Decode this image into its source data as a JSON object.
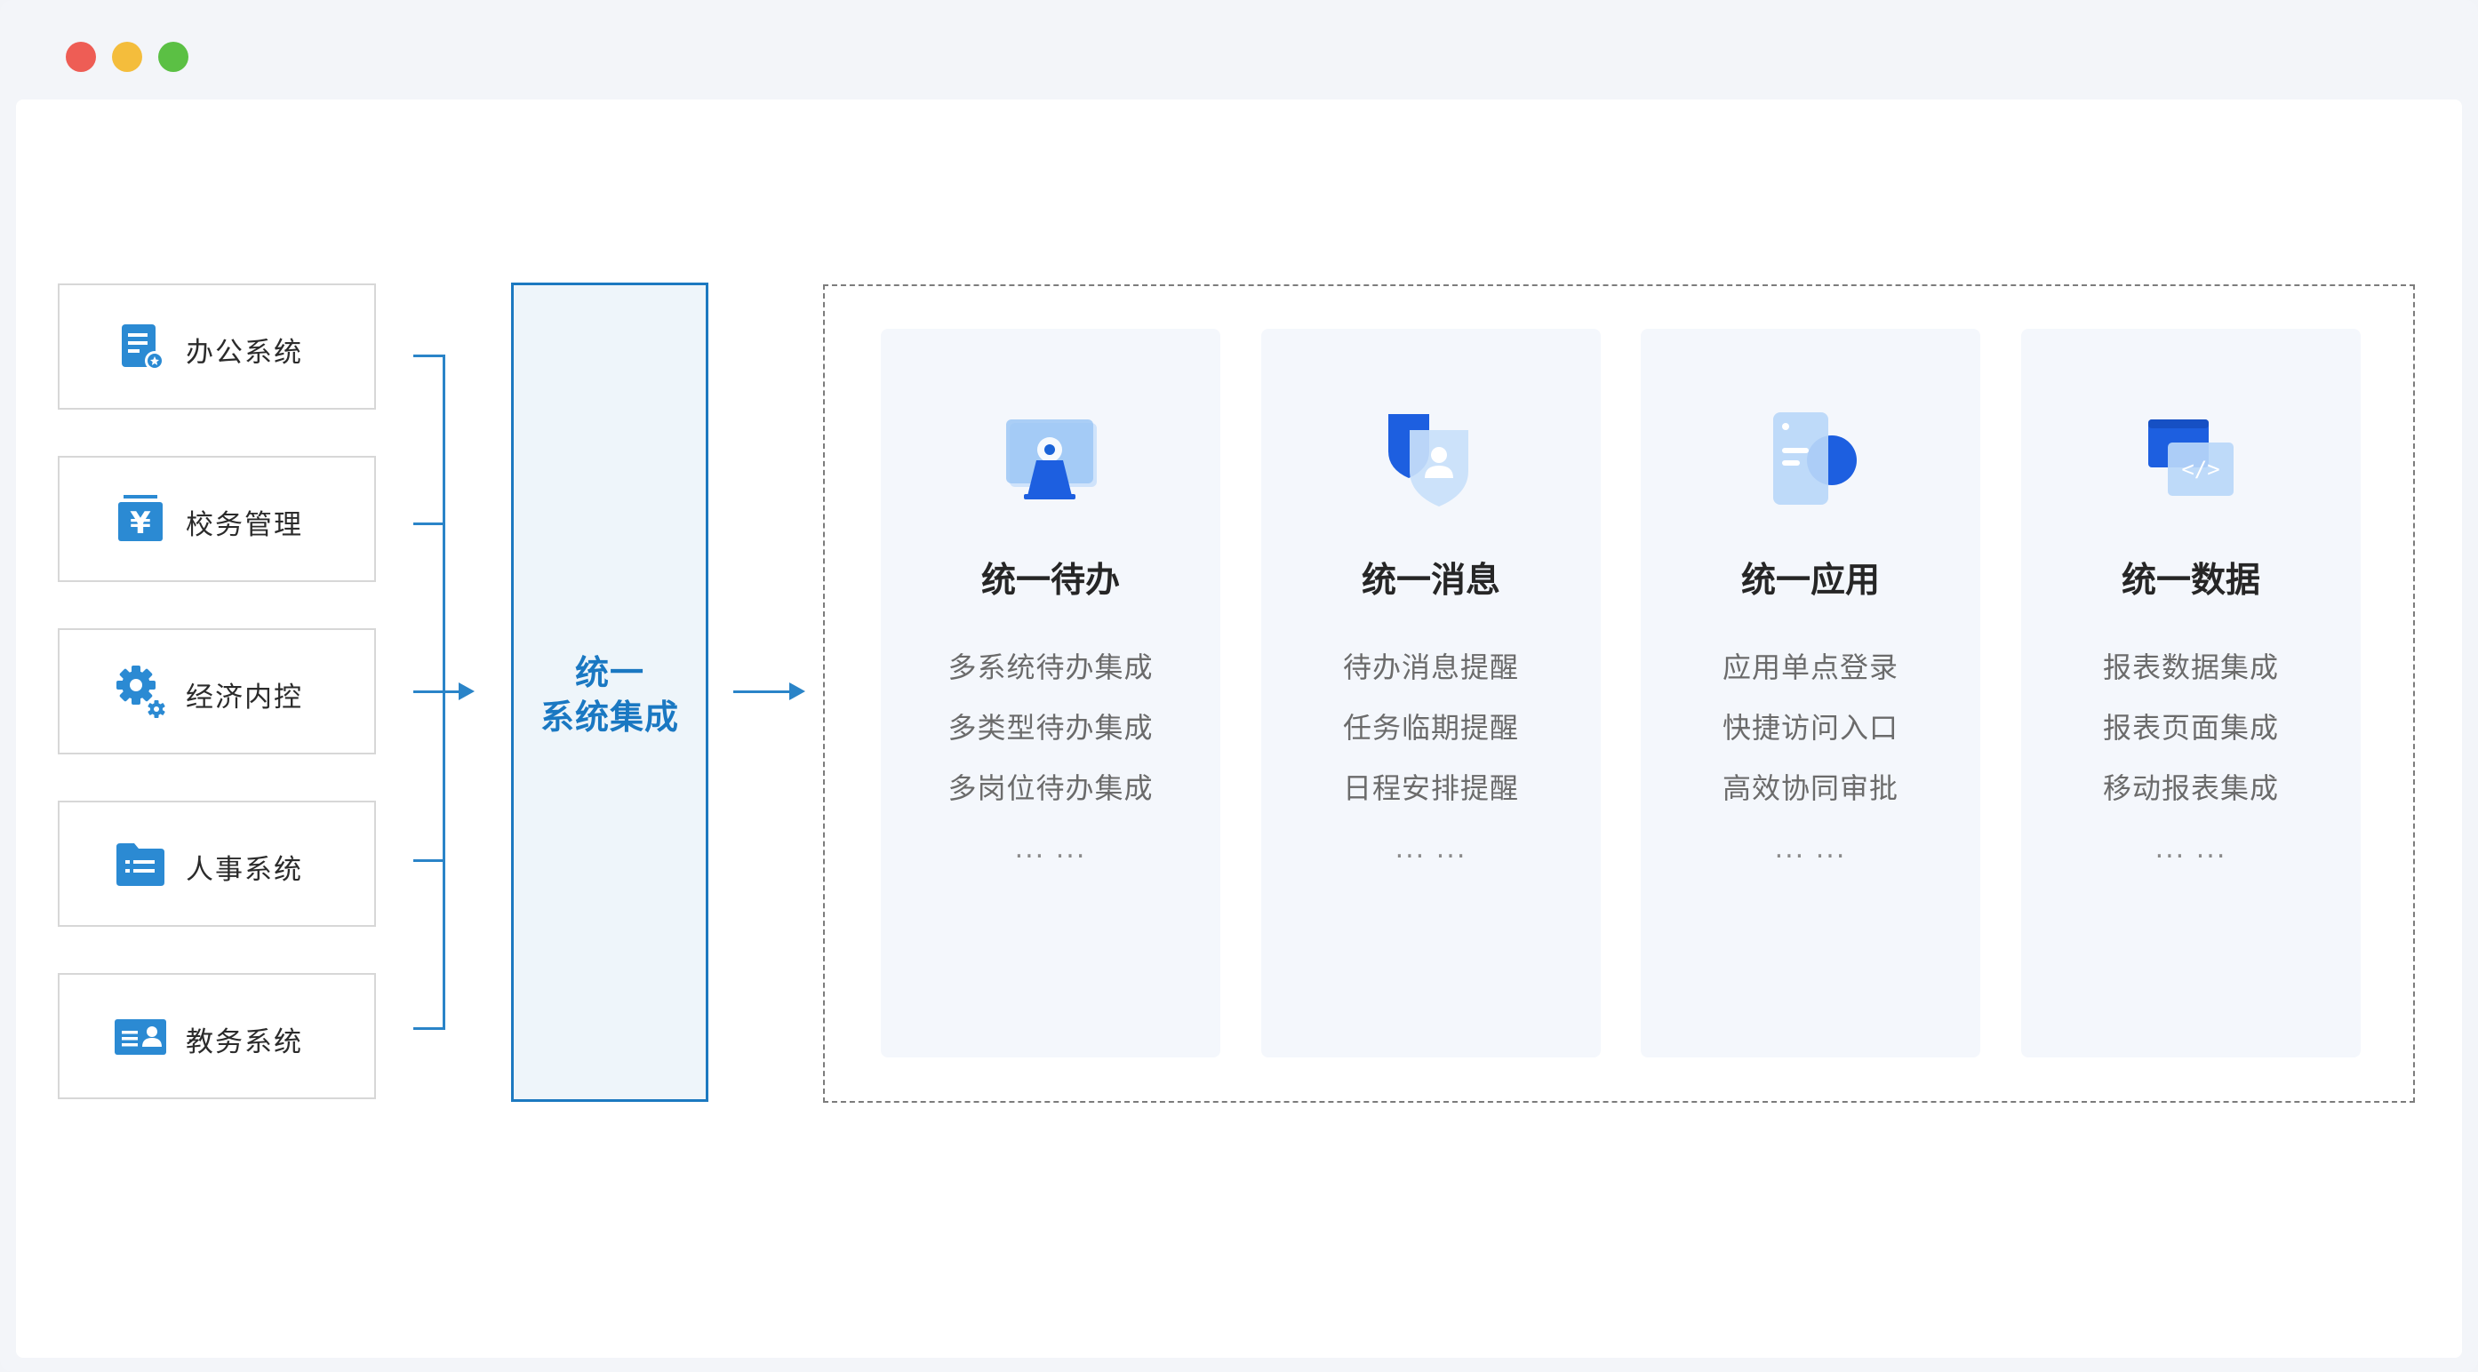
{
  "colors": {
    "accent": "#1c79c0",
    "icon_blue": "#2b8ad3",
    "card_bg": "#f4f7fc",
    "text_dark": "#262626",
    "text_gray": "#6b6b6b"
  },
  "sources": [
    {
      "label": "办公系统",
      "icon": "document-icon"
    },
    {
      "label": "校务管理",
      "icon": "finance-icon"
    },
    {
      "label": "经济内控",
      "icon": "gear-icon"
    },
    {
      "label": "人事系统",
      "icon": "folder-list-icon"
    },
    {
      "label": "教务系统",
      "icon": "id-card-icon"
    }
  ],
  "center": {
    "line1": "统一",
    "line2": "系统集成"
  },
  "cards": [
    {
      "title": "统一待办",
      "icon": "monitor-icon",
      "items": [
        "多系统待办集成",
        "多类型待办集成",
        "多岗位待办集成"
      ],
      "more": "... ..."
    },
    {
      "title": "统一消息",
      "icon": "shield-user-icon",
      "items": [
        "待办消息提醒",
        "任务临期提醒",
        "日程安排提醒"
      ],
      "more": "... ..."
    },
    {
      "title": "统一应用",
      "icon": "app-icon",
      "items": [
        "应用单点登录",
        "快捷访问入口",
        "高效协同审批"
      ],
      "more": "... ..."
    },
    {
      "title": "统一数据",
      "icon": "code-window-icon",
      "items": [
        "报表数据集成",
        "报表页面集成",
        "移动报表集成"
      ],
      "more": "... ..."
    }
  ]
}
